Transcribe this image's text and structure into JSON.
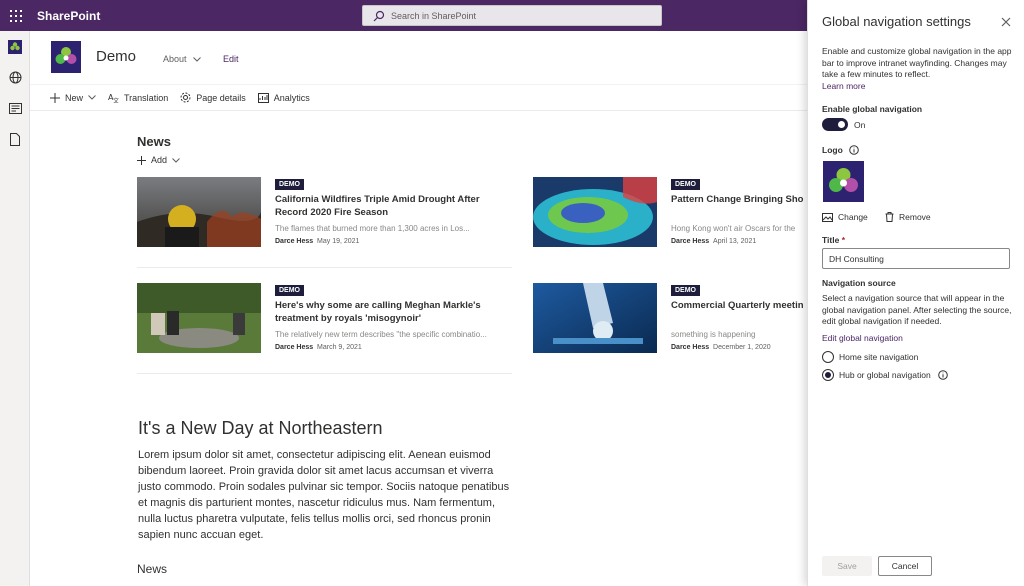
{
  "suite": {
    "brand": "SharePoint",
    "search_placeholder": "Search in SharePoint"
  },
  "appbar": {
    "icons": [
      "site-icon",
      "globe-icon",
      "news-icon",
      "file-icon"
    ]
  },
  "site": {
    "title": "Demo",
    "nav_about": "About",
    "nav_edit": "Edit"
  },
  "command_bar": {
    "new": "New",
    "translation": "Translation",
    "page_details": "Page details",
    "analytics": "Analytics"
  },
  "news": {
    "title": "News",
    "add_label": "Add",
    "items": [
      {
        "badge": "DEMO",
        "title": "California Wildfires Triple Amid Drought After Record 2020 Fire Season",
        "desc": "The flames that burned more than 1,300 acres in Los...",
        "author": "Darce Hess",
        "date": "May 19, 2021"
      },
      {
        "badge": "DEMO",
        "title": "Pattern Change Bringing Sho",
        "desc": "Hong Kong won't air Oscars for the",
        "author": "Darce Hess",
        "date": "April 13, 2021"
      },
      {
        "badge": "DEMO",
        "title": "Here's why some are calling Meghan Markle's treatment by royals 'misogynoir'",
        "desc": "The relatively new term describes \"the specific combinatio...",
        "author": "Darce Hess",
        "date": "March 9, 2021"
      },
      {
        "badge": "DEMO",
        "title": "Commercial Quarterly meetin",
        "desc": "something is happening",
        "author": "Darce Hess",
        "date": "December 1, 2020"
      }
    ]
  },
  "hero": {
    "heading": "It's a New Day at Northeastern",
    "body": "Lorem ipsum dolor sit amet, consectetur adipiscing elit. Aenean euismod bibendum laoreet. Proin gravida dolor sit amet lacus accumsan et viverra justo commodo. Proin sodales pulvinar sic tempor. Sociis natoque penatibus et magnis dis parturient montes, nascetur ridiculus mus. Nam fermentum, nulla luctus pharetra vulputate, felis tellus mollis orci, sed rhoncus pronin sapien nunc accuan eget."
  },
  "news2": {
    "title": "News"
  },
  "panel": {
    "title": "Global navigation settings",
    "description": "Enable and customize global navigation in the app bar to improve intranet wayfinding. Changes may take a few minutes to reflect.",
    "learn_more": "Learn more",
    "enable_label": "Enable global navigation",
    "toggle_state": "On",
    "logo_label": "Logo",
    "change_label": "Change",
    "remove_label": "Remove",
    "title_label": "Title",
    "required_marker": "*",
    "title_value": "DH Consulting",
    "nav_source_label": "Navigation source",
    "nav_source_desc": "Select a navigation source that will appear in the global navigation panel. After selecting the source, edit global navigation if needed.",
    "edit_link": "Edit global navigation",
    "options": [
      {
        "label": "Home site navigation",
        "selected": false
      },
      {
        "label": "Hub or global navigation",
        "selected": true
      }
    ],
    "save_label": "Save",
    "cancel_label": "Cancel"
  },
  "colors": {
    "suite_bar": "#4b2764",
    "accent": "#1e1e3c",
    "link": "#4b2764"
  }
}
